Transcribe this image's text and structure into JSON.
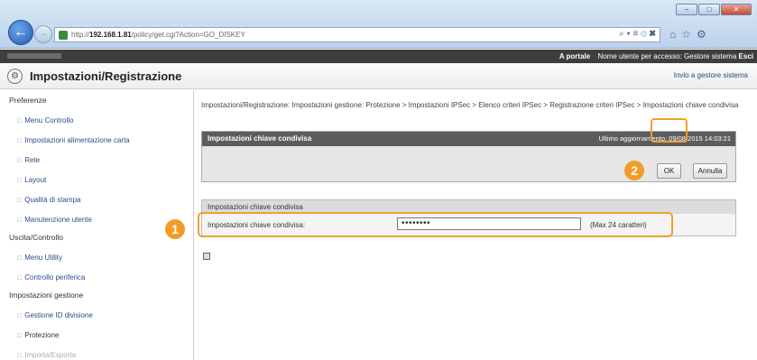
{
  "browser": {
    "url_prefix": "http://",
    "url_host": "192.168.1.81",
    "url_path": "/policy/get.cgi?Action=GO_DISKEY",
    "addr_tools": "⌕ ▾ ≡ ⊙ ✖",
    "min": "–",
    "max": "□",
    "close": "✕"
  },
  "topbar": {
    "portal": "A portale",
    "user_label": "Nome utente per accesso: Gestore sistema",
    "logout": "Esci"
  },
  "header": {
    "title": "Impostazioni/Registrazione",
    "send": "Invio a gestore sistema"
  },
  "sidebar": {
    "sections": [
      {
        "title": "Preferenze",
        "items": [
          "Menu Controllo",
          "Impostazioni alimentazione carta",
          "Rete",
          "Layout",
          "Qualità di stampa",
          "Manutenzione utente"
        ]
      },
      {
        "title": "Uscita/Controllo",
        "items": [
          "Menu Utility",
          "Controllo periferica"
        ]
      },
      {
        "title": "Impostazioni gestione",
        "items": [
          "Gestione ID divisione",
          "Protezione",
          "Importa/Esporta"
        ]
      }
    ]
  },
  "main": {
    "breadcrumb": "Impostazioni/Registrazione: Impostazioni gestione: Protezione > Impostazioni IPSec > Elenco criteri IPSec > Registrazione criteri IPSec > Impostazioni chiave condivisa",
    "panel_title": "Impostazioni chiave condivisa",
    "last_update": "Ultimo aggiornamento: 09/08 2015 14:03:21",
    "ok_label": "OK",
    "cancel_label": "Annulla",
    "form_title": "Impostazioni chiave condivisa",
    "field_label": "Impostazioni chiave condivisa:",
    "field_value": "••••••••",
    "field_hint": "(Max 24 caratteri)"
  },
  "markers": [
    "1",
    "2"
  ],
  "colors": {
    "accent": "#f29c28",
    "header_dark": "#3e3e3e",
    "panel_head": "#5d5d5d"
  }
}
